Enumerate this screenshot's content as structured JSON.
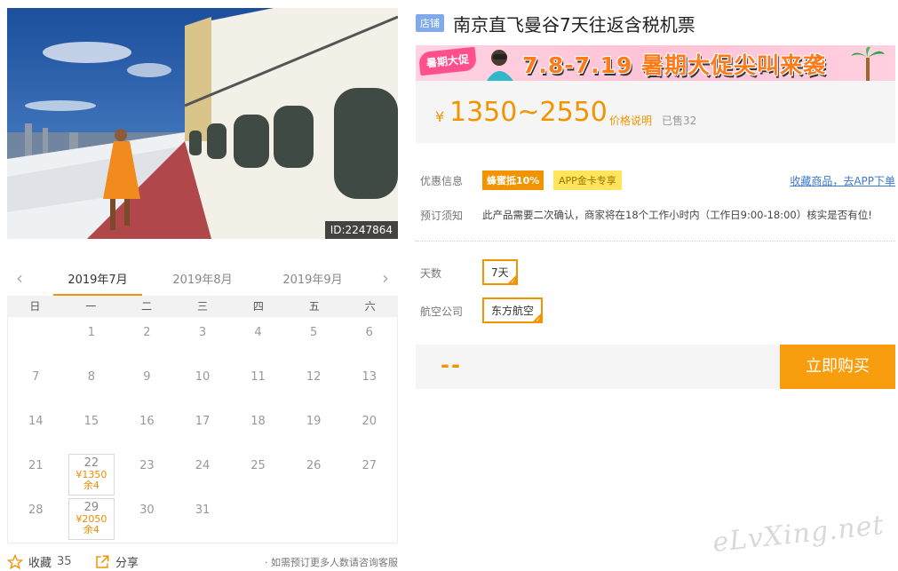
{
  "photo": {
    "id_label": "ID:2247864"
  },
  "calendar": {
    "months": [
      "2019年7月",
      "2019年8月",
      "2019年9月"
    ],
    "weekdays": [
      "日",
      "一",
      "二",
      "三",
      "四",
      "五",
      "六"
    ],
    "days": [
      {
        "d": ""
      },
      {
        "d": "1"
      },
      {
        "d": "2"
      },
      {
        "d": "3"
      },
      {
        "d": "4"
      },
      {
        "d": "5"
      },
      {
        "d": "6"
      },
      {
        "d": "7"
      },
      {
        "d": "8"
      },
      {
        "d": "9"
      },
      {
        "d": "10"
      },
      {
        "d": "11"
      },
      {
        "d": "12"
      },
      {
        "d": "13"
      },
      {
        "d": "14"
      },
      {
        "d": "15"
      },
      {
        "d": "16"
      },
      {
        "d": "17"
      },
      {
        "d": "18"
      },
      {
        "d": "19"
      },
      {
        "d": "20"
      },
      {
        "d": "21"
      },
      {
        "d": "22",
        "price": "¥1350",
        "stock": "余4"
      },
      {
        "d": "23"
      },
      {
        "d": "24"
      },
      {
        "d": "25"
      },
      {
        "d": "26"
      },
      {
        "d": "27"
      },
      {
        "d": "28"
      },
      {
        "d": "29",
        "price": "¥2050",
        "stock": "余4"
      },
      {
        "d": "30"
      },
      {
        "d": "31"
      }
    ]
  },
  "footer": {
    "fav_label": "收藏",
    "fav_count": "35",
    "share_label": "分享",
    "contact_note": "· 如需预订更多人数请咨询客服"
  },
  "product": {
    "store_tag": "店铺",
    "title": "南京直飞曼谷7天往返含税机票"
  },
  "promo": {
    "badge": "暑期大促",
    "text": "7.8-7.19 暑期大促尖叫来袭"
  },
  "price": {
    "currency": "¥",
    "range": "1350~2550",
    "note": "价格说明",
    "sold": "已售32"
  },
  "discount": {
    "label": "优惠信息",
    "tag1": "蜂蜜抵10%",
    "tag2": "APP金卡专享",
    "link": "收藏商品，去APP下单"
  },
  "booking": {
    "label": "预订须知",
    "notice": "此产品需要二次确认，商家将在18个工作小时内（工作日9:00-18:00）核实是否有位!"
  },
  "options": {
    "days_label": "天数",
    "days_value": "7天",
    "airline_label": "航空公司",
    "airline_value": "东方航空"
  },
  "buy": {
    "total": "--",
    "button": "立即购买"
  },
  "watermark": "eLvXing.net",
  "colors": {
    "accent": "#f29400",
    "button": "#f89d0e",
    "link": "#3a78c9",
    "store_tag": "#7fa9e8"
  }
}
